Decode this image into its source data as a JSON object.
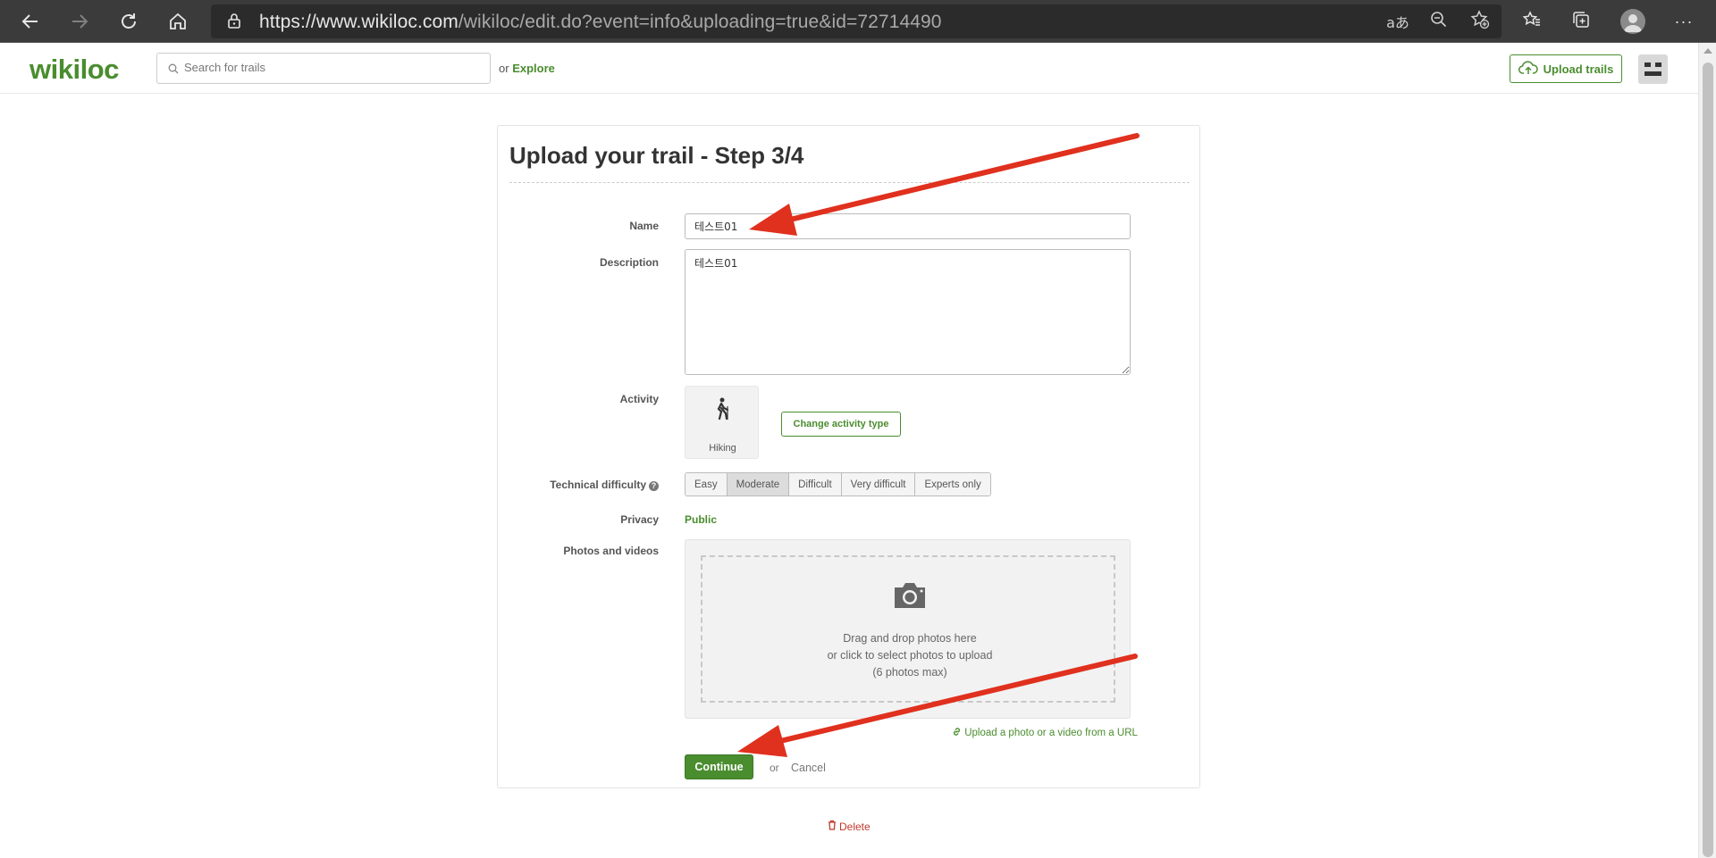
{
  "browser": {
    "url_host": "https://www.wikiloc.com",
    "url_path": "/wikiloc/edit.do?event=info&uploading=true&id=72714490"
  },
  "header": {
    "logo": "wikiloc",
    "search_placeholder": "Search for trails",
    "or_label": "or",
    "explore_label": "Explore",
    "upload_label": "Upload trails"
  },
  "form": {
    "title": "Upload your trail - Step 3/4",
    "name_label": "Name",
    "name_value": "테스트01",
    "description_label": "Description",
    "description_value": "테스트01",
    "activity_label": "Activity",
    "activity_value": "Hiking",
    "change_activity_label": "Change activity type",
    "difficulty_label": "Technical difficulty",
    "difficulty_options": [
      "Easy",
      "Moderate",
      "Difficult",
      "Very difficult",
      "Experts only"
    ],
    "difficulty_selected": "Moderate",
    "privacy_label": "Privacy",
    "privacy_value": "Public",
    "photos_label": "Photos and videos",
    "drop_line1": "Drag and drop photos here",
    "drop_line2": "or click to select photos to upload",
    "drop_line3": "(6 photos max)",
    "upload_url_label": "Upload a photo or a video from a URL",
    "continue_label": "Continue",
    "or_label": "or",
    "cancel_label": "Cancel",
    "delete_label": "Delete"
  },
  "colors": {
    "brand_green": "#4a8d2f",
    "annotation_red": "#e0301e"
  }
}
